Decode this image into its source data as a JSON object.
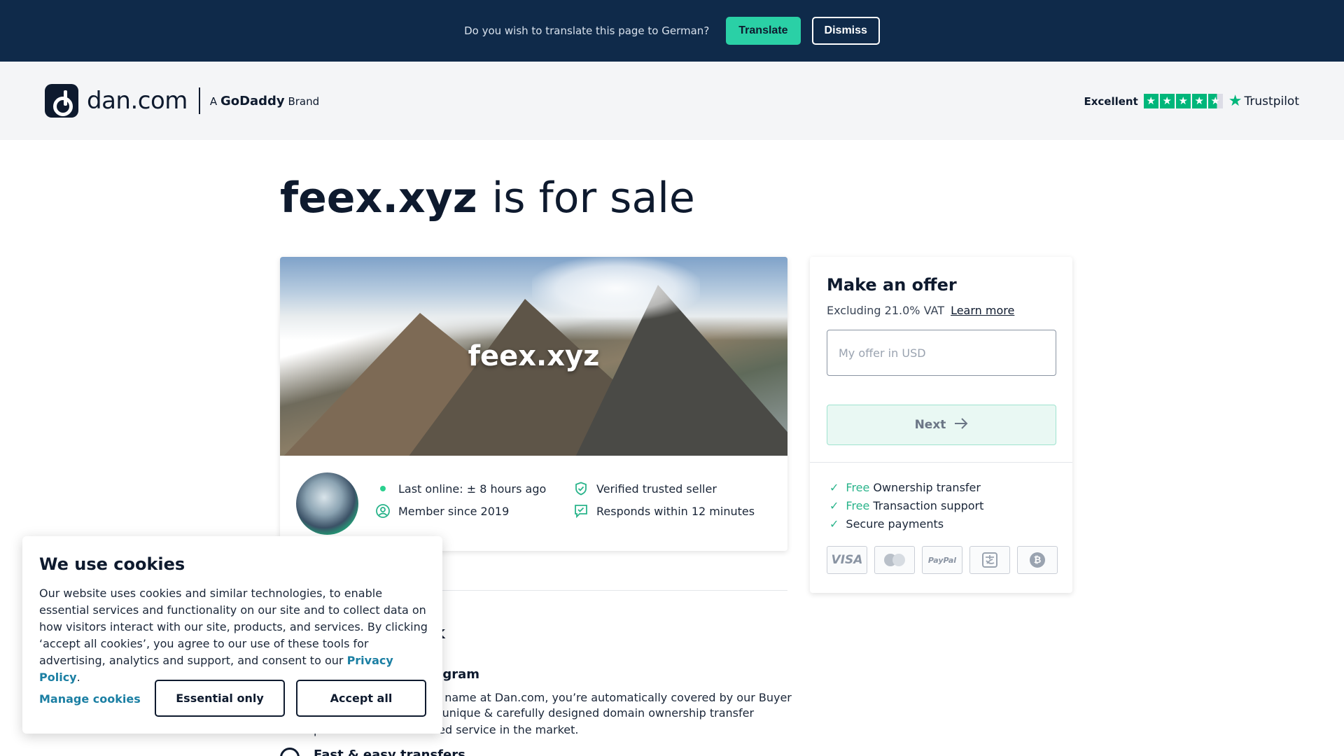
{
  "translate_bar": {
    "prompt": "Do you wish to translate this page to German?",
    "translate_label": "Translate",
    "dismiss_label": "Dismiss"
  },
  "header": {
    "logo_text": "dan.com",
    "brand_prefix": "A",
    "brand_name": "GoDaddy",
    "brand_suffix": "Brand",
    "trustpilot_rating": "Excellent",
    "trustpilot_name": "Trustpilot"
  },
  "headline": {
    "domain": "feex.xyz",
    "rest": "is for sale"
  },
  "hero": {
    "domain": "feex.xyz"
  },
  "seller": {
    "last_online": "Last online: ± 8 hours ago",
    "member_since": "Member since 2019",
    "verified": "Verified trusted seller",
    "responds": "Responds within 12 minutes"
  },
  "offer": {
    "title": "Make an offer",
    "vat_text": "Excluding 21.0% VAT",
    "learn_more": "Learn more",
    "input_placeholder": "My offer in USD",
    "next_label": "Next",
    "benefits": [
      {
        "free": "Free",
        "text": "Ownership transfer"
      },
      {
        "free": "Free",
        "text": "Transaction support"
      },
      {
        "free": "",
        "text": "Secure payments"
      }
    ],
    "payment_methods": [
      "VISA",
      "Mastercard",
      "PayPal",
      "Alipay",
      "Bitcoin"
    ]
  },
  "behind": {
    "heading_fragment": "k",
    "subheading_fragment": "ogram",
    "para_line1": "n name at Dan.com, you’re automatically covered by our Buyer",
    "para_line2": "r unique & carefully designed domain ownership transfer",
    "para_line3": "process is the best rated service in the market.",
    "feature_title_fragment": "Fast & easy transfers"
  },
  "cookies": {
    "title": "We use cookies",
    "body": "Our website uses cookies and similar technologies, to enable essential services and functionality on our site and to collect data on how visitors interact with our site, products, and services. By clicking ‘accept all cookies’, you agree to our use of these tools for advertising, analytics and support, and consent to our",
    "privacy_link": "Privacy Policy",
    "period": ".",
    "manage_label": "Manage cookies",
    "essential_label": "Essential only",
    "accept_label": "Accept all"
  }
}
